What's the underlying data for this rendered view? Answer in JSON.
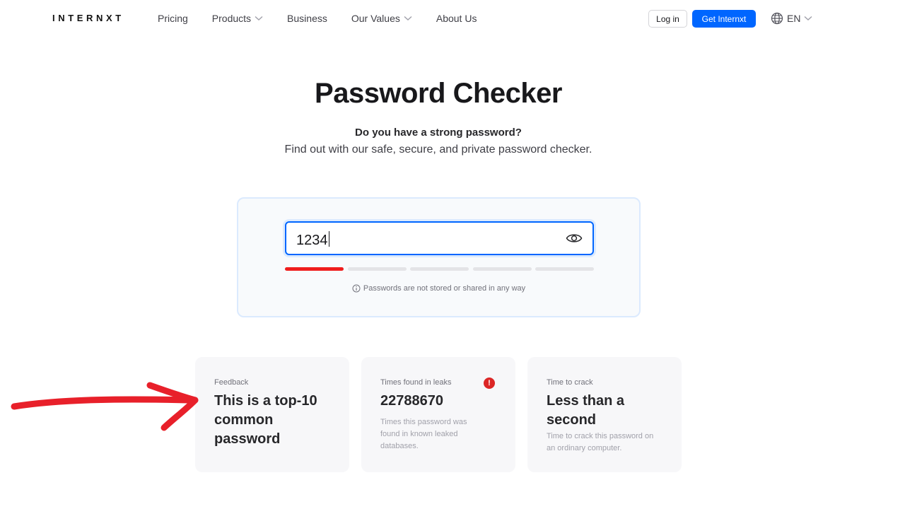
{
  "nav": {
    "logo": "INTERNXT",
    "links": [
      {
        "label": "Pricing",
        "has_dropdown": false
      },
      {
        "label": "Products",
        "has_dropdown": true
      },
      {
        "label": "Business",
        "has_dropdown": false
      },
      {
        "label": "Our Values",
        "has_dropdown": true
      },
      {
        "label": "About Us",
        "has_dropdown": false
      }
    ],
    "login_label": "Log in",
    "cta_label": "Get Internxt",
    "language": "EN"
  },
  "hero": {
    "title": "Password Checker",
    "subtitle": "Do you have a strong password?",
    "description": "Find out with our safe, secure, and private password checker."
  },
  "checker": {
    "password_value": "1234",
    "strength_segments_total": 5,
    "strength_segments_filled": 1,
    "privacy_note": "Passwords are not stored or shared in any way"
  },
  "results": {
    "feedback": {
      "label": "Feedback",
      "value": "This is a top-10 common password"
    },
    "leaks": {
      "label": "Times found in leaks",
      "value": "22788670",
      "note": "Times this password was found in known leaked databases.",
      "alert_symbol": "!"
    },
    "crack": {
      "label": "Time to crack",
      "value": "Less than a second",
      "note": "Time to crack this password on an ordinary computer."
    }
  },
  "colors": {
    "accent": "#0066ff",
    "strength_weak": "#ef1d1d",
    "alert": "#dc2626",
    "annotation_arrow": "#e8202a"
  }
}
